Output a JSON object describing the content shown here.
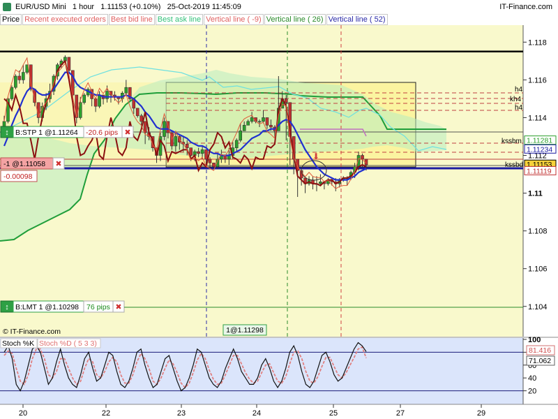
{
  "title": {
    "symbol": "EUR/USD Mini",
    "timeframe": "1 hour",
    "price": "1.11153",
    "change": "(+0.10%)",
    "datetime": "25-Oct-2019 11:45:09",
    "brand": "IT-Finance.com"
  },
  "legend": [
    "Price",
    "Recent executed orders",
    "Best bid line",
    "Best ask line",
    "Vertical line ( -9)",
    "Vertical line ( 26)",
    "Vertical line ( 52)"
  ],
  "watermark": "© IT-Finance.com",
  "orders": {
    "stop": {
      "label": "B:STP 1 @1.11264",
      "pips": "-20.6 pips",
      "close": "✖"
    },
    "position": {
      "label": "-1 @1.11058",
      "pnl": "-0.00098",
      "close": "✖"
    },
    "limit": {
      "label": "B:LMT 1 @1.10298",
      "pips": "76 pips",
      "close": "✖"
    },
    "executed": "1@1.11298"
  },
  "hline_labels": [
    "h4",
    "kh4",
    "h4",
    "kssbm",
    "kssbd"
  ],
  "price_tags": [
    {
      "text": "1.11281",
      "value": 1.11281,
      "color": "#2ca02c"
    },
    {
      "text": "1.11234",
      "value": 1.11234,
      "color": "#1a1aa0"
    },
    {
      "text": "1.11153",
      "value": 1.11153,
      "color": "#000000",
      "bg": "#f7d23a"
    },
    {
      "text": "1.11119",
      "value": 1.11119,
      "color": "#c03030"
    }
  ],
  "stoch_labels": {
    "title": "Stoch %K",
    "d_title": "Stoch %D ( 5 3 3)",
    "k_value": "81.416",
    "d_value": "71.062"
  },
  "chart_data": {
    "type": "candlestick",
    "y_ticks": [
      1.118,
      1.116,
      1.114,
      1.112,
      1.11,
      1.108,
      1.106,
      1.104
    ],
    "y_tick_labels": [
      "1.118",
      "1.116",
      "1.114",
      "1.112",
      "1.11",
      "1.108",
      "1.106",
      "1.104"
    ],
    "ylim": [
      1.1024,
      1.1189
    ],
    "x_ticks": [
      20,
      22,
      23,
      24,
      25,
      27,
      29
    ],
    "x_tick_labels": [
      "20",
      "22",
      "23",
      "24",
      "25",
      "27",
      "29"
    ],
    "candles_close": [
      1.1138,
      1.115,
      1.1156,
      1.1162,
      1.116,
      1.1164,
      1.1168,
      1.1155,
      1.1148,
      1.114,
      1.1146,
      1.115,
      1.1154,
      1.1162,
      1.1168,
      1.117,
      1.1172,
      1.1165,
      1.1152,
      1.114,
      1.1148,
      1.1152,
      1.1155,
      1.115,
      1.1146,
      1.1152,
      1.115,
      1.1154,
      1.1152,
      1.1151,
      1.115,
      1.1153,
      1.1156,
      1.115,
      1.1145,
      1.1141,
      1.1138,
      1.1132,
      1.113,
      1.1124,
      1.112,
      1.113,
      1.1138,
      1.1132,
      1.1125,
      1.113,
      1.1127,
      1.1126,
      1.1124,
      1.112,
      1.1122,
      1.1121,
      1.1123,
      1.1118,
      1.1116,
      1.1114,
      1.1118,
      1.112,
      1.1118,
      1.112,
      1.1124,
      1.1128,
      1.1133,
      1.1136,
      1.1138,
      1.114,
      1.1138,
      1.1138,
      1.114,
      1.1136,
      1.1135,
      1.1133,
      1.1145,
      1.115,
      1.1148,
      1.113,
      1.1118,
      1.1112,
      1.1108,
      1.1105,
      1.1107,
      1.1105,
      1.1105,
      1.1106,
      1.1105,
      1.1107,
      1.1106,
      1.1105,
      1.1107,
      1.1108,
      1.1108,
      1.1111,
      1.1114,
      1.112,
      1.1118,
      1.1115
    ],
    "highline": [
      1.1141,
      1.1151,
      1.1157,
      1.1163,
      1.1165,
      1.1168,
      1.1168,
      1.1158,
      1.115,
      1.1144,
      1.1148,
      1.1153,
      1.1158,
      1.1163,
      1.1169,
      1.1171,
      1.1173,
      1.1167,
      1.1153,
      1.1143,
      1.1151,
      1.1153,
      1.1156,
      1.1154,
      1.1149,
      1.1154,
      1.115,
      1.1157,
      1.1153,
      1.1154,
      1.1151,
      1.1154,
      1.116,
      1.1154,
      1.1148,
      1.1145,
      1.1142,
      1.1133,
      1.1135,
      1.1129,
      1.1124,
      1.1132,
      1.114,
      1.1133,
      1.113,
      1.1133,
      1.1131,
      1.113,
      1.1128,
      1.1121,
      1.1123,
      1.1124,
      1.1125,
      1.1119,
      1.1119,
      1.1116,
      1.1121,
      1.1123,
      1.1119,
      1.1124,
      1.1127,
      1.1129,
      1.1137,
      1.1138,
      1.1139,
      1.1143,
      1.1139,
      1.1139,
      1.1144,
      1.1139,
      1.1139,
      1.1136,
      1.1162,
      1.1154,
      1.1152,
      1.1134,
      1.1119,
      1.1115,
      1.1109,
      1.1106,
      1.1109,
      1.1109,
      1.1109,
      1.111,
      1.1106,
      1.1108,
      1.1108,
      1.1108,
      1.1108,
      1.1109,
      1.1109,
      1.1112,
      1.1116,
      1.1122,
      1.1121,
      1.1117
    ],
    "lowline": [
      1.1132,
      1.1137,
      1.1149,
      1.1155,
      1.1158,
      1.1158,
      1.1163,
      1.1154,
      1.1146,
      1.1137,
      1.1138,
      1.1144,
      1.1148,
      1.1152,
      1.116,
      1.1166,
      1.1169,
      1.1163,
      1.115,
      1.1137,
      1.1139,
      1.1147,
      1.1151,
      1.1146,
      1.1143,
      1.1145,
      1.1147,
      1.1148,
      1.1148,
      1.1149,
      1.1147,
      1.1148,
      1.1152,
      1.1149,
      1.1142,
      1.114,
      1.1135,
      1.1126,
      1.1128,
      1.1122,
      1.1116,
      1.1117,
      1.1128,
      1.1129,
      1.1123,
      1.1122,
      1.1123,
      1.1122,
      1.112,
      1.1117,
      1.1117,
      1.1119,
      1.1118,
      1.1114,
      1.1113,
      1.1113,
      1.1113,
      1.1116,
      1.1116,
      1.1115,
      1.1118,
      1.1122,
      1.1127,
      1.1133,
      1.1136,
      1.1137,
      1.1137,
      1.1135,
      1.1137,
      1.1134,
      1.1133,
      1.1129,
      1.1133,
      1.1145,
      1.1128,
      1.1115,
      1.111,
      1.1098,
      1.1104,
      1.11,
      1.1104,
      1.1102,
      1.1101,
      1.1104,
      1.1102,
      1.1104,
      1.1104,
      1.1101,
      1.1103,
      1.1106,
      1.1104,
      1.1107,
      1.1108,
      1.1112,
      1.1114,
      1.1112
    ],
    "ma_line": [
      1.1125,
      1.113,
      1.1136,
      1.1141,
      1.1145,
      1.115,
      1.1154,
      1.1156,
      1.1155,
      1.1153,
      1.1152,
      1.1152,
      1.1153,
      1.1155,
      1.1158,
      1.1161,
      1.1164,
      1.1164,
      1.1162,
      1.1158,
      1.1156,
      1.1155,
      1.1154,
      1.1153,
      1.1152,
      1.1152,
      1.1151,
      1.1151,
      1.1151,
      1.1151,
      1.1151,
      1.1151,
      1.1152,
      1.1151,
      1.115,
      1.1148,
      1.1146,
      1.1143,
      1.1141,
      1.1138,
      1.1135,
      1.1134,
      1.1134,
      1.1134,
      1.1133,
      1.1132,
      1.1131,
      1.113,
      1.1129,
      1.1127,
      1.1126,
      1.1125,
      1.1125,
      1.1124,
      1.1122,
      1.1121,
      1.1121,
      1.112,
      1.112,
      1.112,
      1.1121,
      1.1122,
      1.1123,
      1.1125,
      1.1127,
      1.1129,
      1.113,
      1.1131,
      1.1133,
      1.1133,
      1.1134,
      1.1134,
      1.1136,
      1.1138,
      1.1139,
      1.1138,
      1.1135,
      1.1131,
      1.1127,
      1.1123,
      1.112,
      1.1117,
      1.1114,
      1.1112,
      1.111,
      1.1109,
      1.1108,
      1.1107,
      1.1107,
      1.1107,
      1.1107,
      1.1108,
      1.1109,
      1.1111,
      1.1112,
      1.1113
    ],
    "red_osc": [
      1.115,
      1.1148,
      1.1144,
      1.1152,
      1.1146,
      1.1137,
      1.1137,
      1.1128,
      1.1118,
      1.113,
      1.114,
      1.1148,
      1.1152,
      1.1157,
      1.1165,
      1.1168,
      1.117,
      1.116,
      1.1148,
      1.113,
      1.112,
      1.1121,
      1.1125,
      1.1128,
      1.1133,
      1.112,
      1.1118,
      1.113,
      1.114,
      1.1132,
      1.1122,
      1.112,
      1.1124,
      1.1138,
      1.113,
      1.1128,
      1.1134,
      1.1143,
      1.1132,
      1.1128,
      1.112,
      1.1128,
      1.1125,
      1.1117,
      1.1122,
      1.1121,
      1.1122,
      1.1123,
      1.1123,
      1.1118,
      1.112,
      1.1112,
      1.1116,
      1.1114,
      1.1123,
      1.1126,
      1.1132,
      1.113,
      1.1124,
      1.1127,
      1.1119,
      1.1118,
      1.1116,
      1.112,
      1.1118,
      1.1113,
      1.1119,
      1.1118,
      1.1118,
      1.1125,
      1.1124,
      1.1126,
      1.1144,
      1.115,
      1.1146,
      1.1133,
      1.112,
      1.1109,
      1.1107,
      1.1105,
      1.1106,
      1.1105,
      1.1105,
      1.1104,
      1.1106,
      1.1107,
      1.1107,
      1.1105,
      1.1106,
      1.1108,
      1.1108,
      1.1109,
      1.1111,
      1.1114,
      1.1115,
      1.1114
    ],
    "stoch_k": [
      80,
      90,
      70,
      30,
      20,
      35,
      60,
      85,
      90,
      80,
      55,
      30,
      40,
      65,
      85,
      60,
      40,
      30,
      25,
      45,
      70,
      80,
      55,
      35,
      40,
      60,
      80,
      75,
      50,
      30,
      25,
      35,
      55,
      80,
      85,
      60,
      40,
      25,
      30,
      50,
      70,
      75,
      55,
      35,
      20,
      25,
      40,
      60,
      85,
      80,
      60,
      40,
      30,
      25,
      35,
      55,
      70,
      85,
      70,
      50,
      40,
      30,
      30,
      40,
      60,
      70,
      55,
      35,
      25,
      35,
      55,
      80,
      90,
      75,
      50,
      30,
      25,
      35,
      55,
      75,
      80,
      65,
      45,
      35,
      40,
      55,
      70,
      85,
      95,
      90,
      81
    ],
    "stoch_d": [
      75,
      82,
      78,
      55,
      35,
      30,
      45,
      70,
      85,
      85,
      70,
      45,
      40,
      50,
      70,
      70,
      55,
      40,
      30,
      35,
      55,
      70,
      65,
      45,
      40,
      50,
      65,
      72,
      65,
      45,
      32,
      32,
      45,
      65,
      78,
      70,
      55,
      35,
      30,
      40,
      55,
      68,
      62,
      48,
      32,
      25,
      32,
      48,
      68,
      78,
      70,
      52,
      38,
      30,
      32,
      45,
      60,
      75,
      75,
      62,
      48,
      38,
      32,
      35,
      48,
      60,
      62,
      48,
      35,
      32,
      42,
      62,
      80,
      82,
      70,
      50,
      35,
      32,
      42,
      58,
      72,
      72,
      58,
      45,
      40,
      48,
      60,
      72,
      85,
      88,
      71
    ],
    "stoch_ylim": [
      0,
      100
    ],
    "stoch_ticks": [
      100,
      80,
      60,
      40,
      20
    ],
    "stoch_tick_labels": [
      "100",
      "80",
      "60",
      "40",
      "20"
    ]
  }
}
